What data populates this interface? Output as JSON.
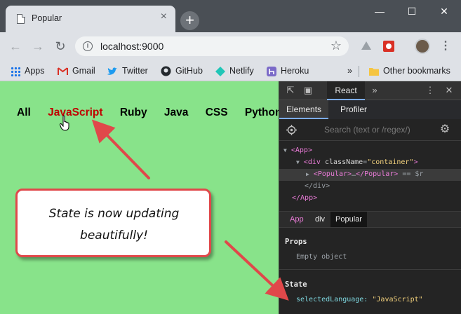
{
  "browser": {
    "tab_title": "Popular",
    "tab_close": "×",
    "newtab": "+",
    "window_controls": {
      "minimize": "—",
      "maximize": "☐",
      "close": "✕"
    },
    "url": "localhost:9000",
    "bookmarks": [
      {
        "label": "Apps",
        "icon": "apps-grid-icon"
      },
      {
        "label": "Gmail",
        "icon": "gmail-icon"
      },
      {
        "label": "Twitter",
        "icon": "twitter-icon"
      },
      {
        "label": "GitHub",
        "icon": "github-icon"
      },
      {
        "label": "Netlify",
        "icon": "netlify-icon"
      },
      {
        "label": "Heroku",
        "icon": "heroku-icon"
      }
    ],
    "bookmarks_overflow": "»",
    "other_bookmarks": "Other bookmarks"
  },
  "page": {
    "nav": [
      "All",
      "JavaScript",
      "Ruby",
      "Java",
      "CSS",
      "Python"
    ],
    "active_language": "JavaScript",
    "background": "#88e38a",
    "active_color": "#c00000",
    "callout_line1": "State is now updating",
    "callout_line2": "beautifully!"
  },
  "devtools": {
    "top_tab": "React",
    "more_tabs": "»",
    "subtabs": {
      "elements": "Elements",
      "profiler": "Profiler"
    },
    "search_placeholder": "Search (text or /regex/)",
    "tree": {
      "app_open": "<App>",
      "div_open_tag": "<div",
      "div_attr": "className",
      "div_eq": "=",
      "div_attr_value": "\"container\"",
      "div_close_bracket": ">",
      "popular_open": "<Popular>",
      "ellipsis": "…",
      "popular_close": "</Popular>",
      "selected_marker": "== $r",
      "div_close": "</div>",
      "app_close": "</App>"
    },
    "breadcrumbs": [
      "App",
      "div",
      "Popular"
    ],
    "props": {
      "heading": "Props",
      "value": "Empty object"
    },
    "state": {
      "heading": "State",
      "key": "selectedLanguage:",
      "value": "\"JavaScript\""
    }
  },
  "colors": {
    "arrow": "#e0484a",
    "accent": "#7cacf8"
  }
}
